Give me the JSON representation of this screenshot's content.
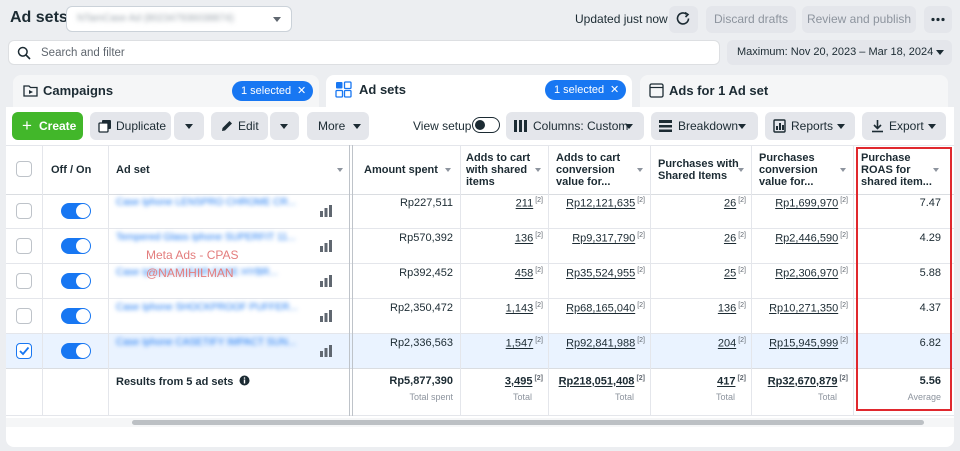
{
  "header": {
    "title": "Ad sets",
    "account_name": "NTamCase Ad (802347936038874)",
    "status": "Updated just now",
    "discard_label": "Discard drafts",
    "review_label": "Review and publish"
  },
  "search": {
    "placeholder": "Search and filter"
  },
  "date_range": "Maximum: Nov 20, 2023 – Mar 18, 2024",
  "tabs": {
    "campaigns": {
      "label": "Campaigns",
      "pill": "1 selected"
    },
    "adsets": {
      "label": "Ad sets",
      "pill": "1 selected"
    },
    "ads": {
      "label": "Ads for 1 Ad set"
    }
  },
  "toolbar": {
    "create": "Create",
    "duplicate": "Duplicate",
    "edit": "Edit",
    "more": "More",
    "view_setup": "View setup",
    "columns": "Columns: Custom",
    "breakdown": "Breakdown",
    "reports": "Reports",
    "export": "Export"
  },
  "columns": {
    "onoff": "Off / On",
    "adset": "Ad set",
    "amount": "Amount spent",
    "adds": [
      "Adds to cart",
      "with shared",
      "items"
    ],
    "addsval": [
      "Adds to cart",
      "conversion",
      "value for..."
    ],
    "purch": [
      "Purchases with",
      "Shared Items"
    ],
    "purchval": [
      "Purchases",
      "conversion",
      "value for..."
    ],
    "roas": [
      "Purchase",
      "ROAS for",
      "shared item..."
    ]
  },
  "rows": [
    {
      "name": "Case Iphone LENSPRO CHROME CR...",
      "amount": "Rp227,511",
      "adds": "211",
      "addsval": "Rp12,121,635",
      "purch": "26",
      "purchval": "Rp1,699,970",
      "roas": "7.47",
      "checked": false
    },
    {
      "name": "Tempered Glass Iphone SUPERFIT 11...",
      "amount": "Rp570,392",
      "adds": "136",
      "addsval": "Rp9,317,790",
      "purch": "26",
      "purchval": "Rp2,446,590",
      "roas": "4.29",
      "checked": false
    },
    {
      "name": "Case Iphone CLEAR CASE HYBR...",
      "amount": "Rp392,452",
      "adds": "458",
      "addsval": "Rp35,524,955",
      "purch": "25",
      "purchval": "Rp2,306,970",
      "roas": "5.88",
      "checked": false
    },
    {
      "name": "Case Iphone SHOCKPROOF PUFFER...",
      "amount": "Rp2,350,472",
      "adds": "1,143",
      "addsval": "Rp68,165,040",
      "purch": "136",
      "purchval": "Rp10,271,350",
      "roas": "4.37",
      "checked": false
    },
    {
      "name": "Case Iphone CASETIFY IMPACT SUN...",
      "amount": "Rp2,336,563",
      "adds": "1,547",
      "addsval": "Rp92,841,988",
      "purch": "204",
      "purchval": "Rp15,945,999",
      "roas": "6.82",
      "checked": true
    }
  ],
  "footnote_mark": "[2]",
  "totals": {
    "label": "Results from 5 ad sets",
    "amount": "Rp5,877,390",
    "amount_sub": "Total spent",
    "adds": "3,495",
    "adds_sub": "Total",
    "addsval": "Rp218,051,408",
    "addsval_sub": "Total",
    "purch": "417",
    "purch_sub": "Total",
    "purchval": "Rp32,670,879",
    "purchval_sub": "Total",
    "roas": "5.56",
    "roas_sub": "Average"
  },
  "watermark": {
    "line1": "Meta Ads - CPAS",
    "line2": "@NAMIHILMAN"
  },
  "colors": {
    "accent": "#1877f2",
    "create": "#42b72a",
    "highlight": "#e0282e"
  }
}
